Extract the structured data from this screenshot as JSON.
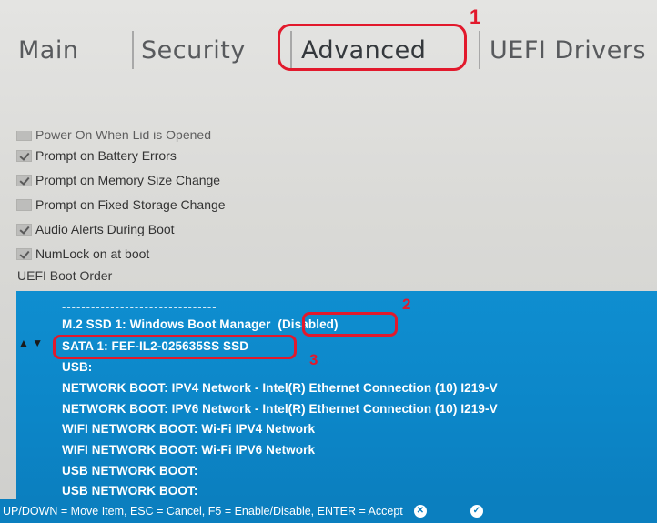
{
  "tabs": [
    {
      "label": "Main"
    },
    {
      "label": "Security"
    },
    {
      "label": "Advanced"
    },
    {
      "label": "UEFI Drivers"
    }
  ],
  "annotations": [
    "1",
    "2",
    "3"
  ],
  "options": [
    {
      "label": "Power On When Lid is Opened",
      "checked": false
    },
    {
      "label": "Prompt on Battery Errors",
      "checked": true
    },
    {
      "label": "Prompt on Memory Size Change",
      "checked": true
    },
    {
      "label": "Prompt on Fixed Storage Change",
      "checked": false
    },
    {
      "label": "Audio Alerts During Boot",
      "checked": true
    },
    {
      "label": "NumLock on at boot",
      "checked": true
    }
  ],
  "boot_section": {
    "title": "UEFI Boot Order",
    "separator": "--------------------------------",
    "items": [
      "M.2 SSD 1:  Windows Boot Manager",
      "SATA 1:  FEF-IL2-025635SS SSD",
      "USB:",
      "NETWORK BOOT:  IPV4 Network - Intel(R) Ethernet Connection (10) I219-V",
      "NETWORK BOOT:  IPV6 Network - Intel(R) Ethernet Connection (10) I219-V",
      "WIFI NETWORK BOOT:  Wi-Fi IPV4 Network",
      "WIFI NETWORK BOOT:  Wi-Fi IPV6 Network",
      "USB NETWORK BOOT:",
      "USB NETWORK BOOT:"
    ],
    "disabled_tag": "(Disabled)",
    "move_arrows": "▲ ▼"
  },
  "footer": {
    "help": "UP/DOWN = Move Item,  ESC = Cancel,  F5 = Enable/Disable,  ENTER = Accept",
    "cancel_icon": "close-icon",
    "accept_icon": "check-icon"
  }
}
